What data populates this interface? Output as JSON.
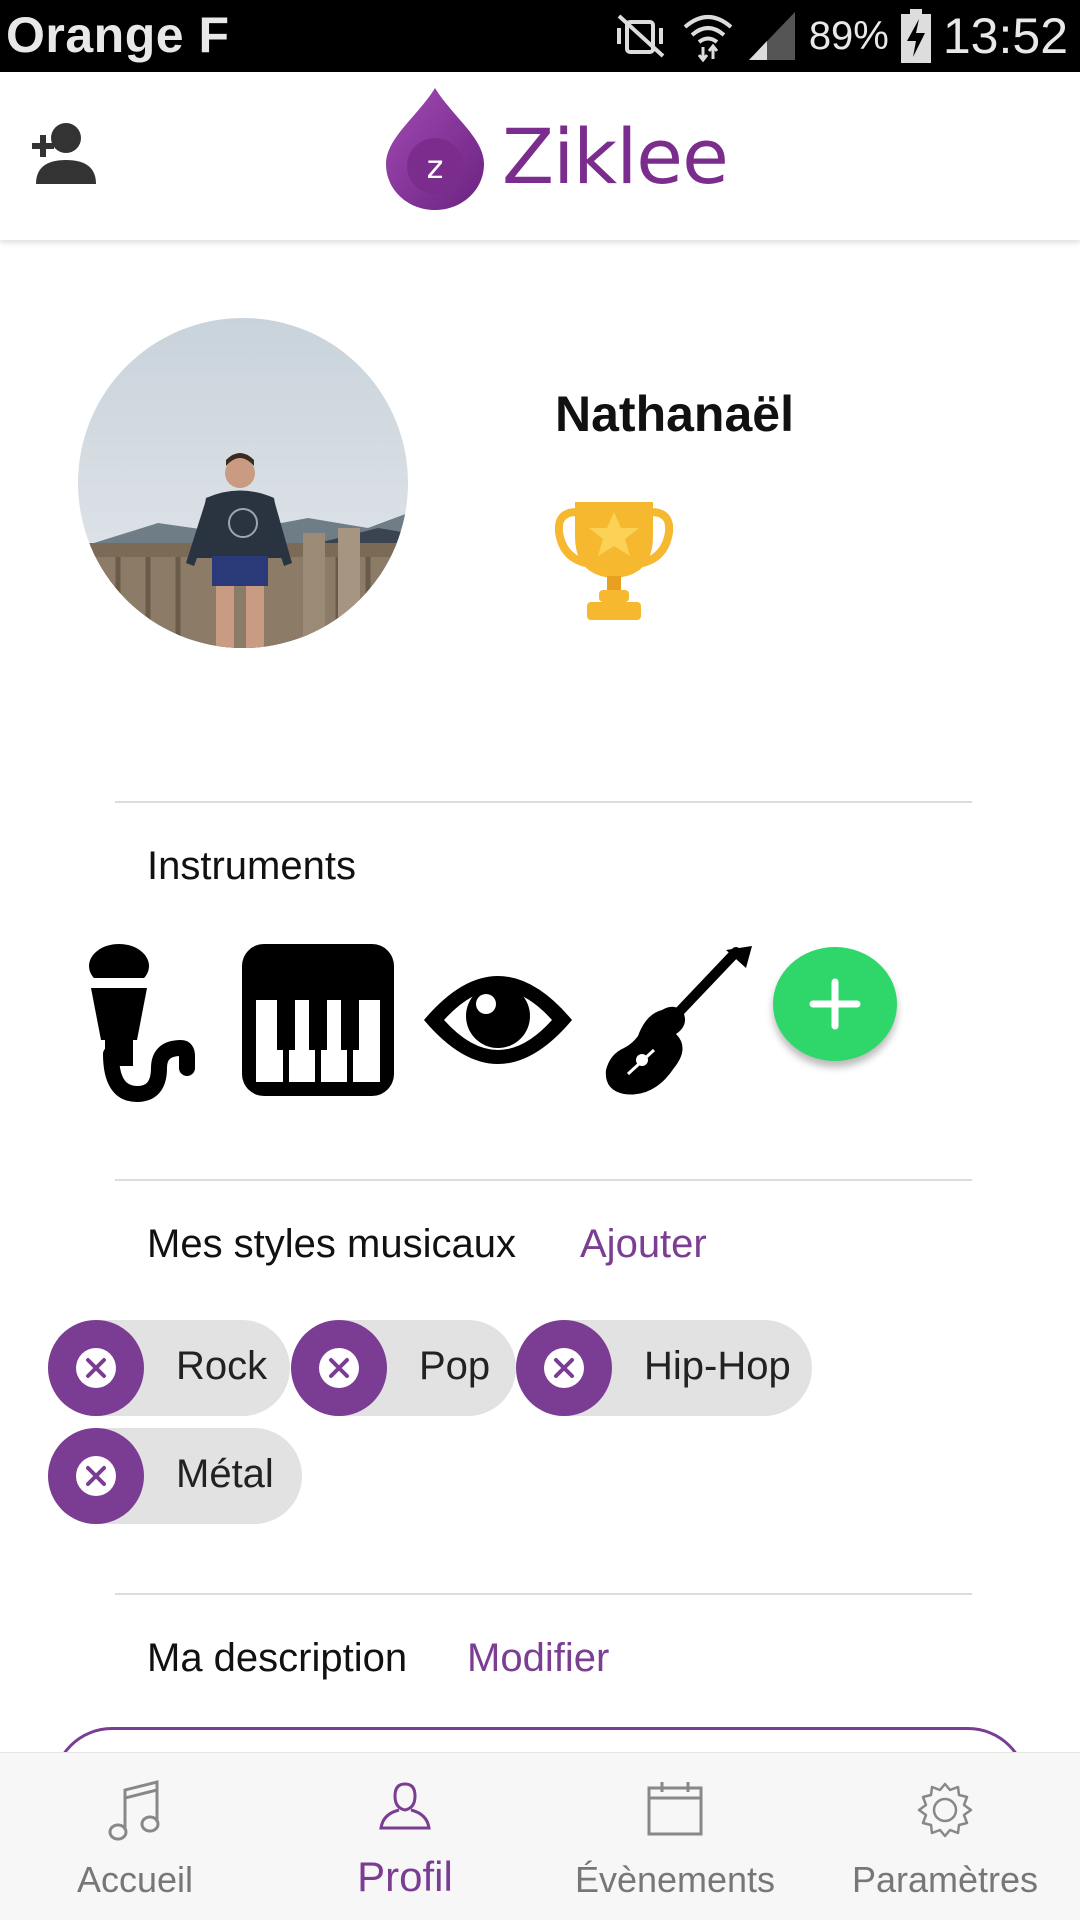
{
  "status_bar": {
    "carrier": "Orange F",
    "battery": "89%",
    "time": "13:52"
  },
  "header": {
    "brand": "Ziklee",
    "logo_letter": "z",
    "add_friend_icon": "person-add-icon"
  },
  "profile": {
    "name": "Nathanaël",
    "badge_icon": "trophy-icon"
  },
  "instruments": {
    "title": "Instruments",
    "items": [
      {
        "icon": "microphone-icon"
      },
      {
        "icon": "piano-keys-icon"
      },
      {
        "icon": "eye-icon"
      },
      {
        "icon": "guitar-icon"
      }
    ],
    "add_icon": "plus-icon"
  },
  "styles": {
    "title": "Mes styles musicaux",
    "action": "Ajouter",
    "chips": [
      {
        "label": "Rock"
      },
      {
        "label": "Pop"
      },
      {
        "label": "Hip-Hop"
      },
      {
        "label": "Métal"
      }
    ]
  },
  "description": {
    "title": "Ma description",
    "action": "Modifier"
  },
  "nav": {
    "items": [
      {
        "label": "Accueil",
        "icon": "music-note-icon"
      },
      {
        "label": "Profil",
        "icon": "person-icon"
      },
      {
        "label": "Évènements",
        "icon": "calendar-icon"
      },
      {
        "label": "Paramètres",
        "icon": "gear-icon"
      }
    ],
    "active": "Profil"
  },
  "colors": {
    "brand_purple": "#7b3d93",
    "add_green": "#2fd66a",
    "chip_grey": "#e2e2e2",
    "trophy_gold": "#f5b82e"
  }
}
